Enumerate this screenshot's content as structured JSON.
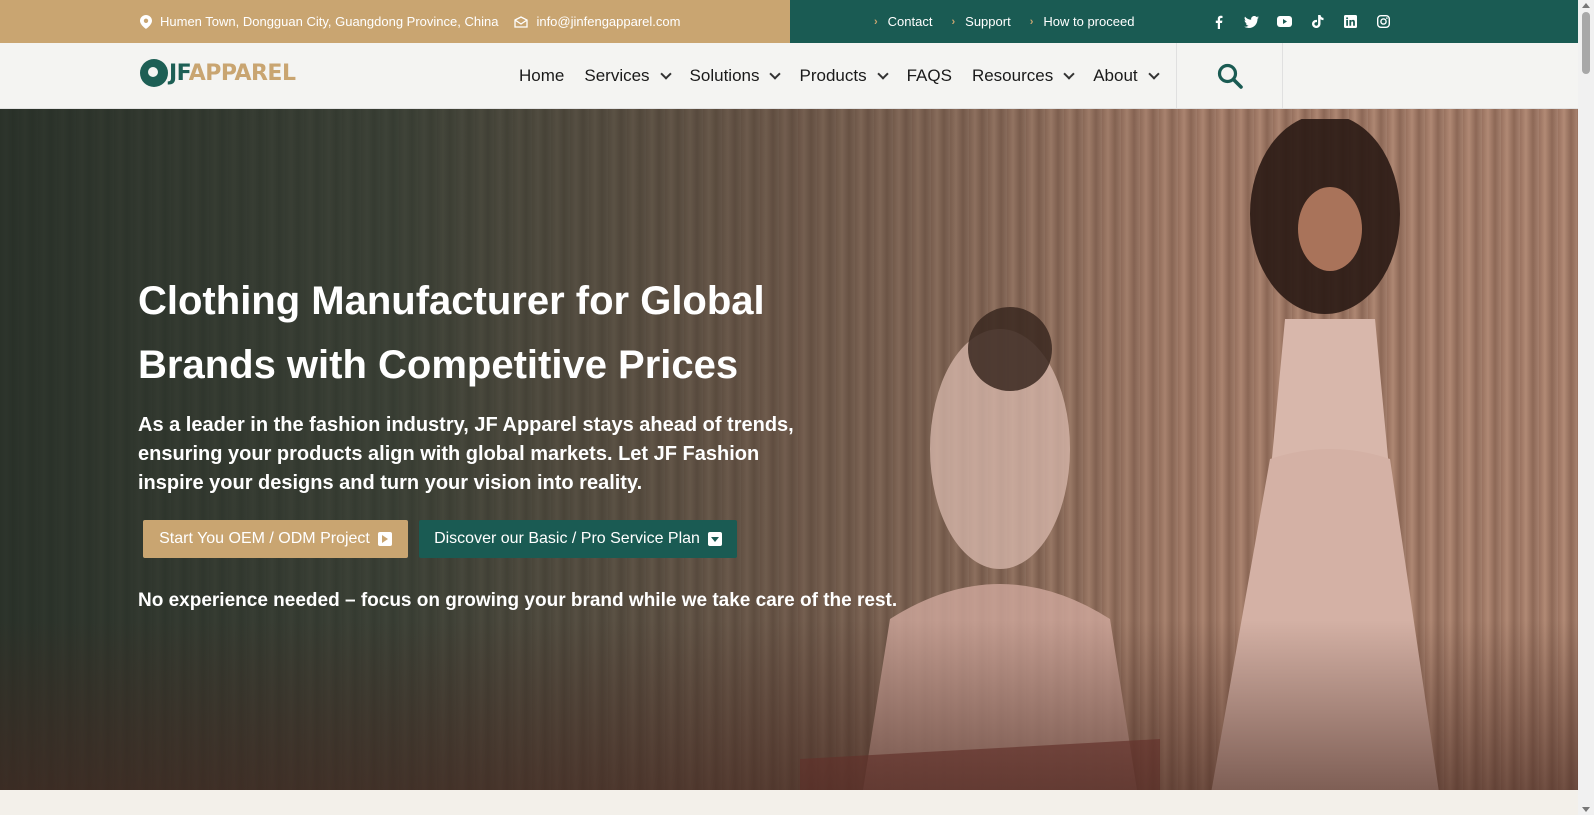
{
  "topbar": {
    "address": "Humen Town, Dongguan City, Guangdong Province, China",
    "email": "info@jinfengapparel.com",
    "links": [
      {
        "label": "Contact"
      },
      {
        "label": "Support"
      },
      {
        "label": "How to proceed"
      }
    ],
    "socials": [
      "facebook-icon",
      "twitter-icon",
      "youtube-icon",
      "tiktok-icon",
      "linkedin-icon",
      "instagram-icon"
    ]
  },
  "logo": {
    "jf": "JF",
    "apparel": "APPAREL"
  },
  "nav": {
    "items": [
      {
        "label": "Home",
        "dropdown": false
      },
      {
        "label": "Services",
        "dropdown": true
      },
      {
        "label": "Solutions",
        "dropdown": true
      },
      {
        "label": "Products",
        "dropdown": true
      },
      {
        "label": "FAQS",
        "dropdown": false
      },
      {
        "label": "Resources",
        "dropdown": true
      },
      {
        "label": "About",
        "dropdown": true
      }
    ]
  },
  "hero": {
    "title": "Clothing Manufacturer for Global Brands with Competitive Prices",
    "subtitle": "As a leader in the fashion industry, JF Apparel stays ahead of trends, ensuring your products align with global markets. Let JF Fashion inspire your designs and turn your vision into reality.",
    "cta_primary": "Start You OEM / ODM Project",
    "cta_secondary": "Discover our Basic / Pro Service Plan",
    "note": "No experience needed – focus on growing your brand while we take care of the rest."
  },
  "colors": {
    "gold": "#c9a571",
    "teal": "#1a5b53"
  }
}
